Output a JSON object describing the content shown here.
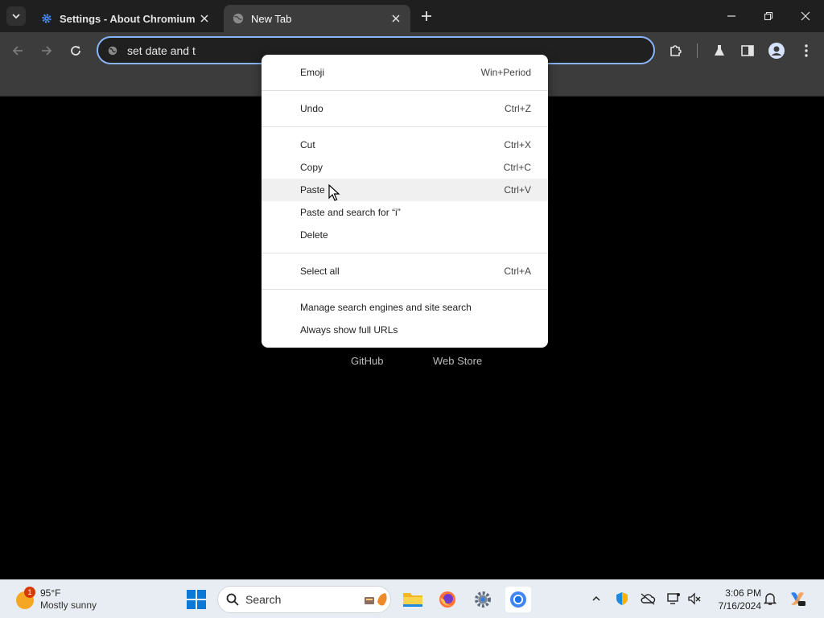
{
  "tabs": [
    {
      "title": "Settings - About Chromium",
      "icon": "gear-icon"
    },
    {
      "title": "New Tab",
      "icon": "globe-icon"
    }
  ],
  "omnibox": {
    "text": "set date and t"
  },
  "shortcuts": [
    "GitHub",
    "Web Store"
  ],
  "context_menu": {
    "groups": [
      [
        {
          "label": "Emoji",
          "shortcut": "Win+Period"
        }
      ],
      [
        {
          "label": "Undo",
          "shortcut": "Ctrl+Z"
        }
      ],
      [
        {
          "label": "Cut",
          "shortcut": "Ctrl+X"
        },
        {
          "label": "Copy",
          "shortcut": "Ctrl+C"
        },
        {
          "label": "Paste",
          "shortcut": "Ctrl+V"
        },
        {
          "label": "Paste and search for “i”",
          "shortcut": ""
        },
        {
          "label": "Delete",
          "shortcut": ""
        }
      ],
      [
        {
          "label": "Select all",
          "shortcut": "Ctrl+A"
        }
      ],
      [
        {
          "label": "Manage search engines and site search",
          "shortcut": ""
        },
        {
          "label": "Always show full URLs",
          "shortcut": ""
        }
      ]
    ],
    "hovered": "Paste"
  },
  "taskbar": {
    "weather": {
      "badge": "1",
      "temp": "95°F",
      "condition": "Mostly sunny"
    },
    "search_placeholder": "Search",
    "clock": {
      "time": "3:06 PM",
      "date": "7/16/2024"
    }
  },
  "colors": {
    "accent": "#8ab4f8",
    "tabstrip": "#1f1f1f",
    "toolbar": "#3c3c3c",
    "menu_bg": "#ffffff"
  }
}
